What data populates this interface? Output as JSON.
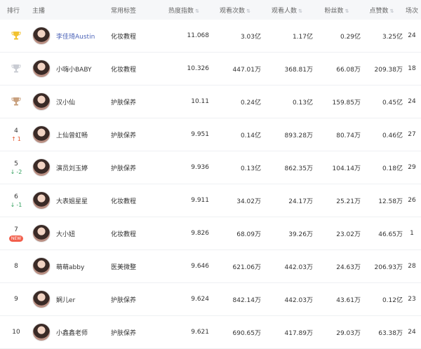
{
  "header": {
    "rank": "排行",
    "host": "主播",
    "tag": "常用标签",
    "heat": "热度指数",
    "views": "观看次数",
    "viewers": "观看人数",
    "fans": "粉丝数",
    "likes": "点赞数",
    "sessions": "场次"
  },
  "rows": [
    {
      "rank": "1",
      "change": "",
      "name": "李佳琦Austin",
      "tag": "化妆教程",
      "heat": "11.068",
      "views": "3.03亿",
      "viewers": "1.17亿",
      "fans": "0.29亿",
      "likes": "3.25亿",
      "sessions": "24"
    },
    {
      "rank": "2",
      "change": "",
      "name": "小嗨小BABY",
      "tag": "化妆教程",
      "heat": "10.326",
      "views": "447.01万",
      "viewers": "368.81万",
      "fans": "66.08万",
      "likes": "209.38万",
      "sessions": "18"
    },
    {
      "rank": "3",
      "change": "",
      "name": "汉小仙",
      "tag": "护肤保养",
      "heat": "10.11",
      "views": "0.24亿",
      "viewers": "0.13亿",
      "fans": "159.85万",
      "likes": "0.45亿",
      "sessions": "24"
    },
    {
      "rank": "4",
      "change": "1",
      "name": "上仙曾虹畅",
      "tag": "护肤保养",
      "heat": "9.951",
      "views": "0.14亿",
      "viewers": "893.28万",
      "fans": "80.74万",
      "likes": "0.46亿",
      "sessions": "27"
    },
    {
      "rank": "5",
      "change": "-2",
      "name": "演员刘玉婷",
      "tag": "护肤保养",
      "heat": "9.936",
      "views": "0.13亿",
      "viewers": "862.35万",
      "fans": "104.14万",
      "likes": "0.18亿",
      "sessions": "29"
    },
    {
      "rank": "6",
      "change": "-1",
      "name": "大表姐星星",
      "tag": "化妆教程",
      "heat": "9.911",
      "views": "34.02万",
      "viewers": "24.17万",
      "fans": "25.21万",
      "likes": "12.58万",
      "sessions": "26"
    },
    {
      "rank": "7",
      "change": "NEW",
      "name": "大小妞",
      "tag": "化妆教程",
      "heat": "9.826",
      "views": "68.09万",
      "viewers": "39.26万",
      "fans": "23.02万",
      "likes": "46.65万",
      "sessions": "1"
    },
    {
      "rank": "8",
      "change": "",
      "name": "萌萌abby",
      "tag": "医美微整",
      "heat": "9.646",
      "views": "621.06万",
      "viewers": "442.03万",
      "fans": "24.63万",
      "likes": "206.93万",
      "sessions": "28"
    },
    {
      "rank": "9",
      "change": "",
      "name": "娴儿er",
      "tag": "护肤保养",
      "heat": "9.624",
      "views": "842.14万",
      "viewers": "442.03万",
      "fans": "43.61万",
      "likes": "0.12亿",
      "sessions": "23"
    },
    {
      "rank": "10",
      "change": "",
      "name": "小鑫鑫老师",
      "tag": "护肤保养",
      "heat": "9.621",
      "views": "690.65万",
      "viewers": "417.89万",
      "fans": "29.03万",
      "likes": "63.38万",
      "sessions": "24"
    }
  ],
  "colors": {
    "gold": "#f2c230",
    "silver": "#c9ccd3",
    "bronze": "#c8a07e",
    "up": "#e4572e",
    "down": "#2e9e5b"
  }
}
